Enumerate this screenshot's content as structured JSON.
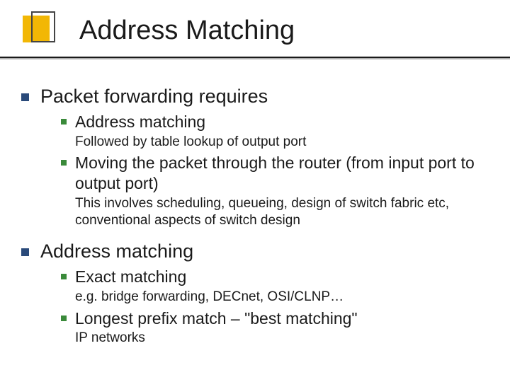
{
  "title": "Address Matching",
  "items": [
    {
      "text": "Packet forwarding requires",
      "children": [
        {
          "text": "Address matching",
          "sub": "Followed by table lookup of output port"
        },
        {
          "text": "Moving the packet through the router (from input port to output port)",
          "sub": "This involves scheduling, queueing, design of switch fabric etc, conventional aspects of switch design"
        }
      ]
    },
    {
      "text": "Address matching",
      "children": [
        {
          "text": "Exact matching",
          "sub": "e.g. bridge forwarding, DECnet, OSI/CLNP…"
        },
        {
          "text": "Longest prefix match – \"best matching\"",
          "sub": "IP networks"
        }
      ]
    }
  ]
}
